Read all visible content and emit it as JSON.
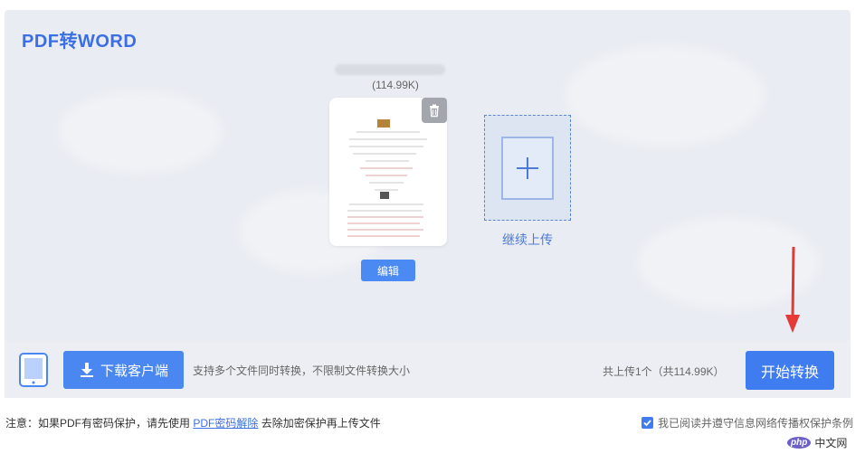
{
  "header": {
    "title": "PDF转WORD"
  },
  "file": {
    "size": "(114.99K)",
    "edit_label": "编辑"
  },
  "upload": {
    "more_label": "继续上传"
  },
  "toolbar": {
    "download_label": "下载客户端",
    "support_text": "支持多个文件同时转换，不限制文件转换大小",
    "total_text": "共上传1个（共114.99K）",
    "start_label": "开始转换"
  },
  "footer": {
    "note_prefix": "注意：如果PDF有密码保护，请先使用",
    "note_link": "PDF密码解除",
    "note_suffix": "去除加密保护再上传文件",
    "agree_text": "我已阅读并遵守信息网络传播权保护条例",
    "agree_checked": true
  },
  "watermark": {
    "logo": "php",
    "text": "中文网"
  },
  "colors": {
    "accent": "#3f7cf0",
    "title": "#3b6fe3",
    "arrow": "#e53935"
  },
  "icons": [
    "trash-icon",
    "plus-icon",
    "tablet-icon",
    "download-icon",
    "check-icon",
    "arrow-down-icon"
  ]
}
